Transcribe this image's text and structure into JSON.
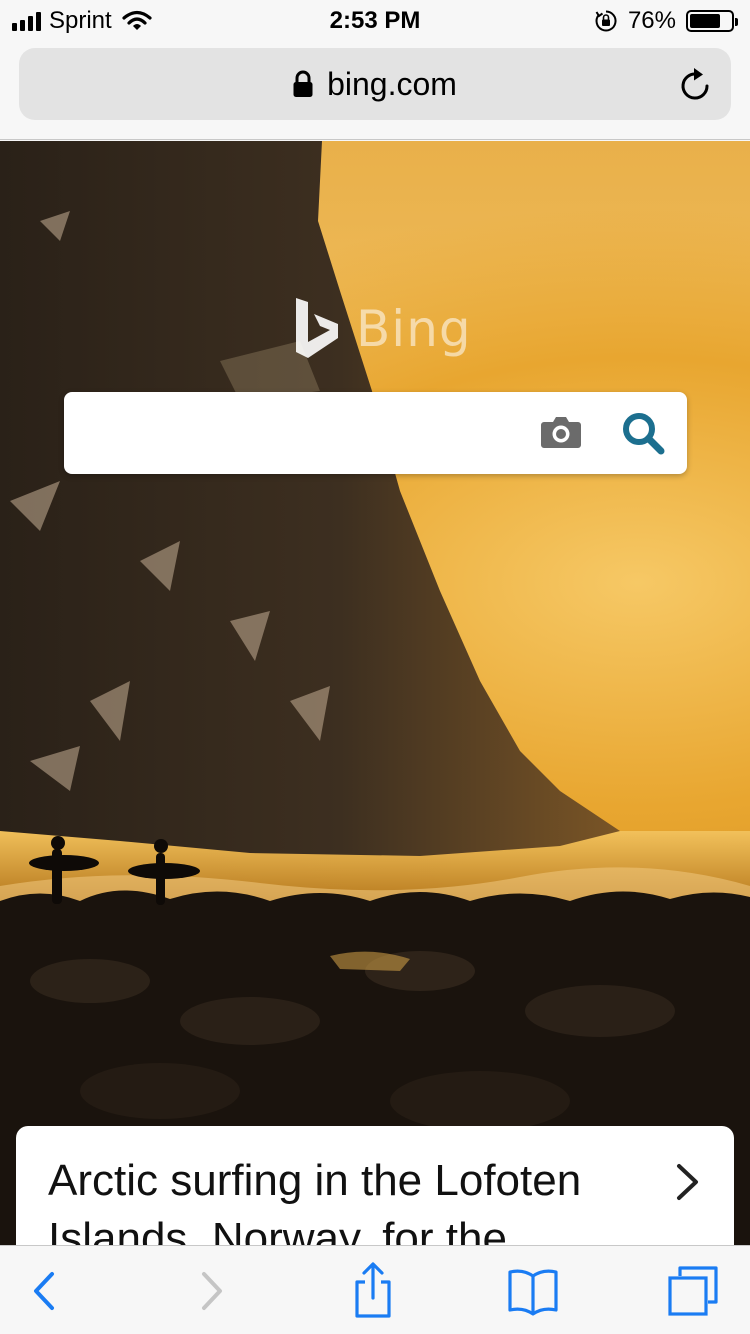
{
  "status_bar": {
    "carrier": "Sprint",
    "time": "2:53 PM",
    "battery_percent": "76%",
    "battery_level": 0.76,
    "icons": [
      "signal-icon",
      "wifi-icon",
      "orientation-lock-icon",
      "battery-icon"
    ]
  },
  "browser": {
    "url": "bing.com",
    "icons": {
      "lock": "lock-icon",
      "reload": "reload-icon"
    }
  },
  "page": {
    "logo_text": "Bing",
    "search": {
      "value": "",
      "placeholder": ""
    },
    "icons": {
      "camera": "camera-icon",
      "search": "search-icon"
    },
    "caption": "Arctic surfing in the Lofoten Islands, Norway, for the",
    "colors": {
      "search_icon": "#1c6f8f",
      "camera_icon": "#6b6b6b",
      "toolbar_icon_active": "#1a7cf3",
      "toolbar_icon_disabled": "#c5c5c5"
    }
  },
  "toolbar": {
    "buttons": [
      {
        "name": "back",
        "icon": "chevron-left-icon",
        "enabled": true
      },
      {
        "name": "forward",
        "icon": "chevron-right-icon",
        "enabled": false
      },
      {
        "name": "share",
        "icon": "share-icon",
        "enabled": true
      },
      {
        "name": "bookmarks",
        "icon": "book-icon",
        "enabled": true
      },
      {
        "name": "tabs",
        "icon": "tabs-icon",
        "enabled": true
      }
    ]
  }
}
